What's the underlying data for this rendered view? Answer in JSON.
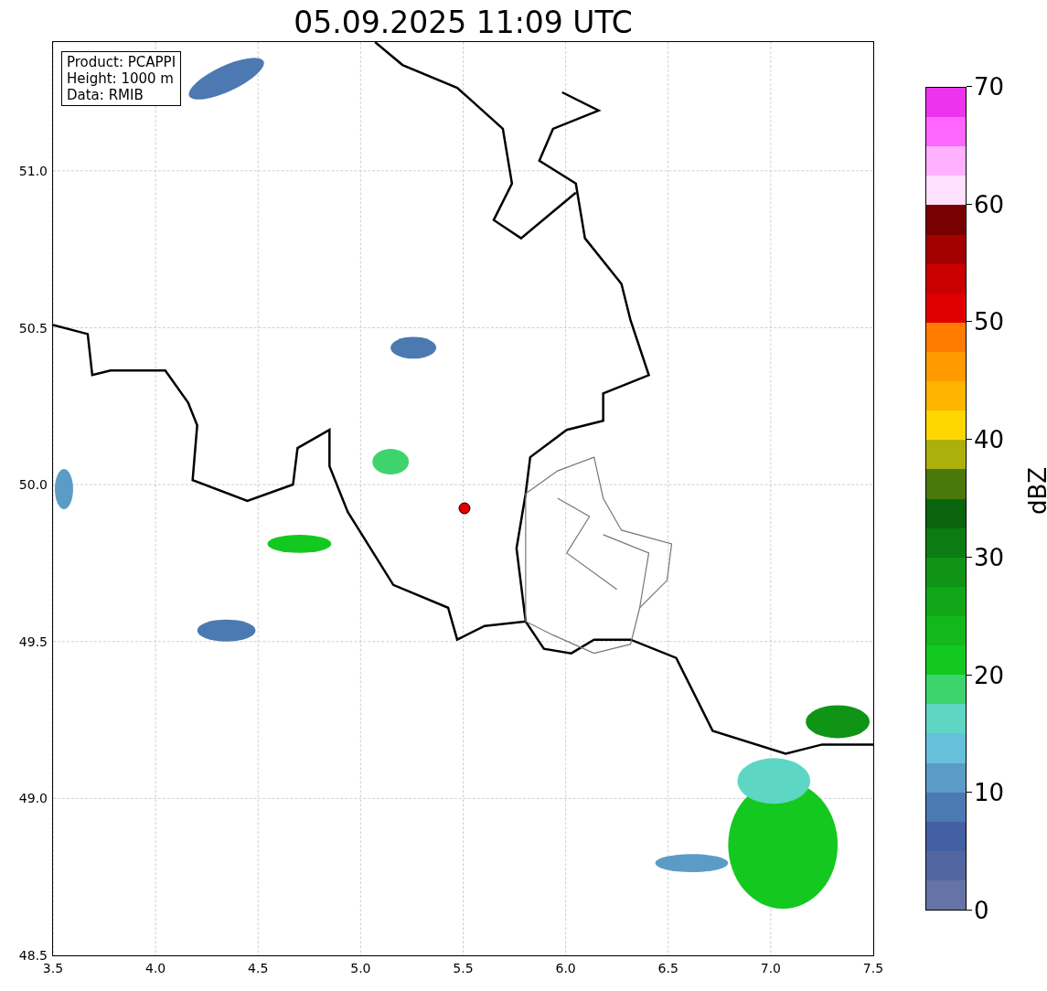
{
  "title": "05.09.2025 11:09 UTC",
  "info_box": {
    "lines": [
      "Product: PCAPPI",
      "Height: 1000 m",
      "Data: RMIB"
    ]
  },
  "map": {
    "x_ticks": [
      "3.5",
      "4.0",
      "4.5",
      "5.0",
      "5.5",
      "6.0",
      "6.5",
      "7.0",
      "7.5"
    ],
    "y_ticks": [
      "51.0",
      "50.5",
      "50.0",
      "49.5",
      "49.0",
      "48.5"
    ]
  },
  "colorbar": {
    "label": "dBZ",
    "ticks": [
      "70",
      "60",
      "50",
      "40",
      "30",
      "20",
      "10",
      "0"
    ],
    "bins": [
      {
        "color": "#ee33ee"
      },
      {
        "color": "#ff66ff"
      },
      {
        "color": "#ffb0ff"
      },
      {
        "color": "#ffe0ff"
      },
      {
        "color": "#780000"
      },
      {
        "color": "#a50000"
      },
      {
        "color": "#c80000"
      },
      {
        "color": "#e00000"
      },
      {
        "color": "#ff7c00"
      },
      {
        "color": "#ff9a00"
      },
      {
        "color": "#ffb400"
      },
      {
        "color": "#ffd700"
      },
      {
        "color": "#adb00a"
      },
      {
        "color": "#4a780a"
      },
      {
        "color": "#0a640e"
      },
      {
        "color": "#0c7c12"
      },
      {
        "color": "#0f9416"
      },
      {
        "color": "#10a718"
      },
      {
        "color": "#12b81c"
      },
      {
        "color": "#13c91f"
      },
      {
        "color": "#3dd46e"
      },
      {
        "color": "#5ed6c4"
      },
      {
        "color": "#66c0dc"
      },
      {
        "color": "#5b9cc6"
      },
      {
        "color": "#4d79b2"
      },
      {
        "color": "#4460a4"
      },
      {
        "color": "#5466a0"
      },
      {
        "color": "#6574a6"
      }
    ]
  }
}
